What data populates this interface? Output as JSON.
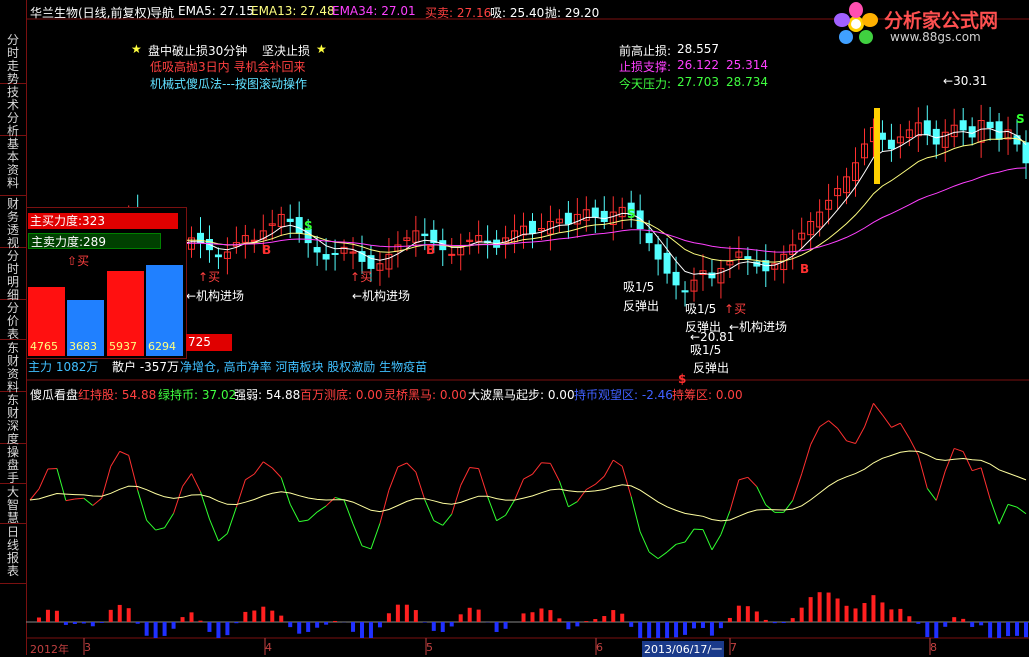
{
  "header": {
    "stock_name": "华兰生物(日线,前复权)",
    "nav_label": "导航",
    "ema5": "EMA5: 27.15",
    "ema13": "EMA13: 27.48",
    "ema34": "EMA34: 27.01",
    "buysell": "买卖: 27.16",
    "xi": "吸: 25.40",
    "pao": "抛: 29.20"
  },
  "logo": {
    "title": "分析家公式网",
    "url": "www.88gs.com"
  },
  "sidebar_tabs": [
    "分时走势",
    "技术分析",
    "基本资料",
    "财务透视",
    "分时明细",
    "分价表",
    "东财资料",
    "东财深度",
    "操盘手",
    "大智慧",
    "日线报表"
  ],
  "notes": {
    "line1": "盘中破止损30分钟",
    "line1b": "坚决止损",
    "line2": "低吸高抛3日内 寻机会补回来",
    "line3": "机械式傻瓜法---按图滚动操作"
  },
  "levels": {
    "prev_high_label": "前高止损:",
    "prev_high": "28.557",
    "stop_label": "止损支撑:",
    "stop1": "26.122",
    "stop2": "25.314",
    "pressure_label": "今天压力:",
    "press1": "27.703",
    "press2": "28.734"
  },
  "popup": {
    "main_buy": "主买力度:323",
    "main_sell": "主卖力度:289",
    "buy_label": "买",
    "bar_values": [
      "4765",
      "3683",
      "5937",
      "6294"
    ],
    "extra_value": "725"
  },
  "info_line": {
    "main_force": "主力 1082万",
    "retail": "散户 -357万",
    "sectors": "净增仓, 高市净率 河南板块 股权激励 生物疫苗"
  },
  "annotations": {
    "buy": "买",
    "institution": "←机构进场",
    "xi15": "吸1/5",
    "rebound": "反弹出",
    "low_mark": "←20.81",
    "high_mark": "30.31",
    "s_mark": "S",
    "b_mark": "B",
    "dollar_mark": "$"
  },
  "indicator": {
    "name": "傻瓜看盘",
    "red_hold": "红持股: 54.88",
    "green_hold": "绿持币: 37.02",
    "strength": "强弱: 54.88",
    "million": "百万测底: 0.00",
    "lingqiao": "灵桥黑马: 0.00",
    "dabo": "大波黑马起步: 0.00",
    "observe": "持币观望区: -2.46",
    "hold_zone": "持筹区: 0.00"
  },
  "xaxis": {
    "year": "2012年",
    "ticks": [
      "3",
      "4",
      "5",
      "6",
      "7",
      "8"
    ],
    "cursor_date": "2013/06/17/一"
  },
  "colors": {
    "up": "#ff3030",
    "down": "#54ffff",
    "ema5": "#ffffff",
    "ema13": "#ffff80",
    "ema34": "#ff40ff",
    "red_line": "#ff3030",
    "green_line": "#30ff30",
    "yellow_line": "#ffffa0"
  },
  "chart_data": {
    "type": "line",
    "candles_close": [
      24.6,
      24.4,
      24.8,
      25.1,
      24.7,
      25.3,
      25.6,
      25.2,
      24.9,
      25.4,
      25.8,
      26.1,
      25.7,
      25.3,
      25.1,
      24.8,
      24.6,
      24.9,
      25.2,
      25.0,
      24.7,
      24.4,
      24.6,
      25.0,
      25.3,
      25.1,
      25.5,
      25.8,
      26.2,
      25.9,
      25.4,
      25.0,
      24.6,
      24.3,
      24.5,
      24.8,
      24.6,
      24.2,
      23.9,
      24.1,
      24.5,
      24.9,
      25.2,
      25.5,
      25.3,
      25.0,
      24.7,
      24.5,
      24.8,
      25.1,
      25.3,
      25.0,
      24.8,
      25.2,
      25.5,
      25.7,
      25.4,
      25.6,
      25.9,
      26.0,
      25.8,
      26.2,
      26.4,
      26.1,
      25.9,
      26.3,
      26.5,
      26.2,
      25.6,
      25.0,
      24.3,
      23.7,
      23.2,
      22.9,
      23.4,
      23.8,
      23.5,
      23.9,
      24.2,
      24.6,
      24.3,
      24.0,
      23.8,
      24.1,
      24.5,
      24.9,
      25.4,
      25.9,
      26.3,
      26.8,
      27.3,
      27.8,
      28.4,
      29.2,
      29.9,
      29.4,
      29.0,
      29.5,
      29.8,
      30.1,
      29.6,
      29.2,
      29.7,
      30.0,
      29.8,
      29.5,
      30.2,
      29.9,
      29.4,
      29.8,
      29.2,
      28.4
    ],
    "ema5": [],
    "indicator_red": [],
    "indicator_green": [],
    "ylabel": "",
    "xlabel": ""
  }
}
